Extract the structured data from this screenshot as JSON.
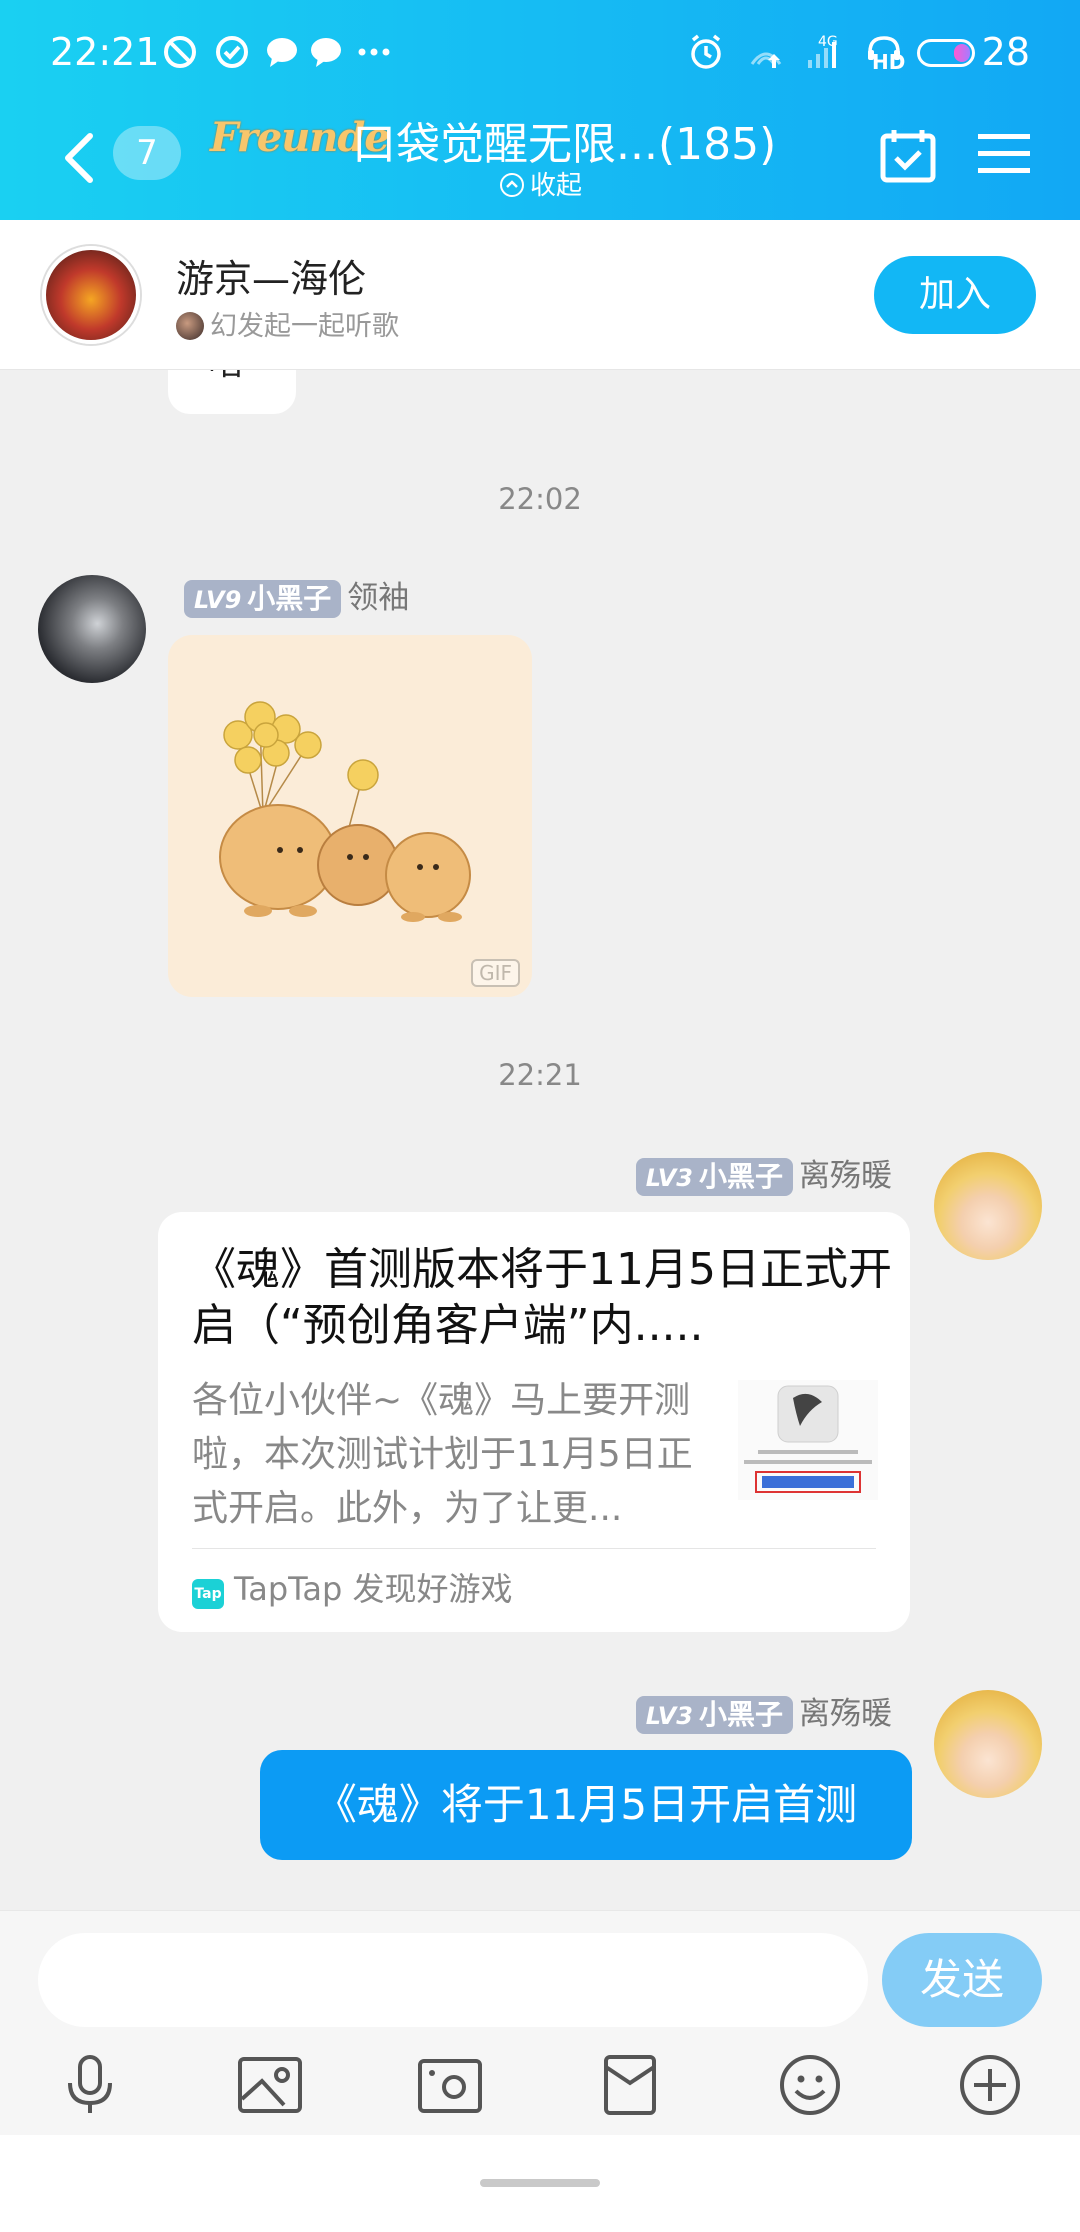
{
  "status_bar": {
    "time": "22:21",
    "network": "4G",
    "hd": "HD",
    "battery": "28"
  },
  "nav": {
    "unread_count": "7",
    "logo_text": "Freunde",
    "title": "口袋觉醒无限...(185)",
    "collapse_label": "收起"
  },
  "join_bar": {
    "title": "游京—海伦",
    "subtitle": "幻发起一起听歌",
    "join_label": "加入"
  },
  "chat": {
    "partial_text": "啥",
    "messages": [
      {
        "type": "timestamp",
        "text": "22:02"
      },
      {
        "type": "sticker",
        "level": "LV9",
        "rank": "小黑子",
        "name": "领袖",
        "gif_tag": "GIF"
      },
      {
        "type": "timestamp",
        "text": "22:21"
      },
      {
        "type": "card",
        "level": "LV3",
        "rank": "小黑子",
        "name": "离殇暖",
        "title": "《魂》首测版本将于11月5日正式开启（“预创角客户端”内.....",
        "desc": "各位小伙伴~《魂》马上要开测啦，本次测试计划于11月5日正式开启。此外，为了让更...",
        "source": "TapTap 发现好游戏",
        "source_badge": "Tap"
      },
      {
        "type": "text",
        "level": "LV3",
        "rank": "小黑子",
        "name": "离殇暖",
        "text": "《魂》将于11月5日开启首测"
      }
    ]
  },
  "input_bar": {
    "placeholder": "",
    "send_label": "发送",
    "tools": [
      "microphone-icon",
      "image-icon",
      "camera-icon",
      "red-packet-icon",
      "emoji-icon",
      "plus-icon"
    ]
  },
  "colors": {
    "header_start": "#1ad0f2",
    "header_end": "#12a8f4",
    "accent": "#12b7f5",
    "sent_bubble": "#0c9bf4",
    "level_badge": "#a9b3c8"
  }
}
